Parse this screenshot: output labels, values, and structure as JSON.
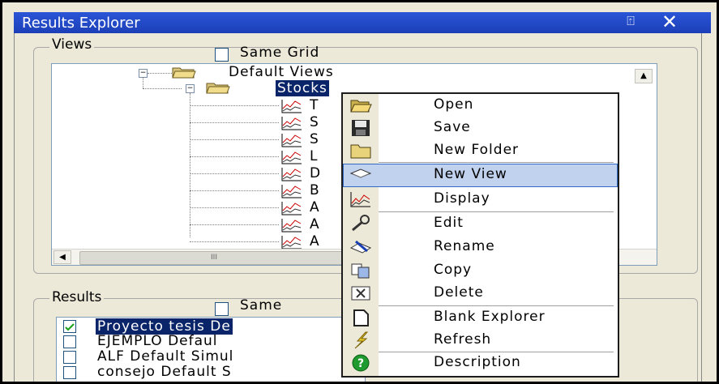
{
  "window": {
    "title": "Results Explorer",
    "pin_glyph": "⍐",
    "close_glyph": "✕"
  },
  "views": {
    "group_label": "Views",
    "same_grid_label": "Same Grid",
    "same_grid_checked": false,
    "tree": {
      "root": "Default Views",
      "selected": "Stocks",
      "children_partial": [
        "T",
        "S",
        "S",
        "L",
        "D",
        "B",
        "A",
        "A",
        "A"
      ]
    },
    "scroll_up_glyph": "▲",
    "scroll_left_glyph": "◀",
    "scroll_grip": "III"
  },
  "results": {
    "group_label": "Results",
    "same_label_partial": "Same",
    "rows": [
      {
        "text": "Proyecto tesis De",
        "checked": true,
        "selected": true
      },
      {
        "text": "EJEMPLO Defaul",
        "checked": false,
        "selected": false
      },
      {
        "text": "ALF Default Simul",
        "checked": false,
        "selected": false
      },
      {
        "text": "consejo Default S",
        "checked": false,
        "selected": false
      }
    ]
  },
  "context_menu": {
    "items": [
      {
        "label": "Open",
        "icon": "open-folder-icon"
      },
      {
        "label": "Save",
        "icon": "floppy-disk-icon"
      },
      {
        "label": "New Folder",
        "icon": "folder-icon"
      },
      {
        "label": "New View",
        "icon": "new-view-icon",
        "highlighted": true
      },
      {
        "label": "Display",
        "icon": "chart-icon"
      },
      {
        "label": "Edit",
        "icon": "wrench-icon"
      },
      {
        "label": "Rename",
        "icon": "rename-icon"
      },
      {
        "label": "Copy",
        "icon": "copy-icon"
      },
      {
        "label": "Delete",
        "icon": "delete-icon"
      },
      {
        "label": "Blank Explorer",
        "icon": "blank-page-icon"
      },
      {
        "label": "Refresh",
        "icon": "lightning-icon"
      },
      {
        "label": "Description",
        "icon": "help-icon"
      }
    ]
  },
  "colors": {
    "titlebar": "#1c3fb8",
    "selection": "#0a246a",
    "menu_highlight": "#c1d2ee",
    "menu_border_highlight": "#316ac5"
  }
}
